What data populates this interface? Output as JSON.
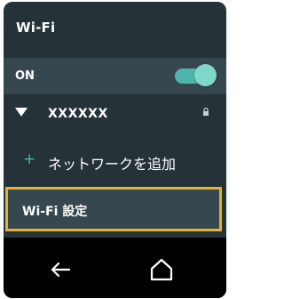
{
  "header": {
    "title": "Wi-Fi"
  },
  "wifi_toggle": {
    "label": "ON",
    "state": "on",
    "accent_color": "#4db6ac"
  },
  "network": {
    "name": "XXXXXX",
    "icon": "wifi-signal-icon",
    "lock_icon": "lock-icon"
  },
  "add_network": {
    "icon": "+",
    "label": "ネットワークを追加"
  },
  "settings": {
    "label": "Wi-Fi 設定",
    "highlight_color": "#e1b23b"
  },
  "navbar": {
    "back_icon": "back-arrow-icon",
    "home_icon": "home-icon"
  }
}
